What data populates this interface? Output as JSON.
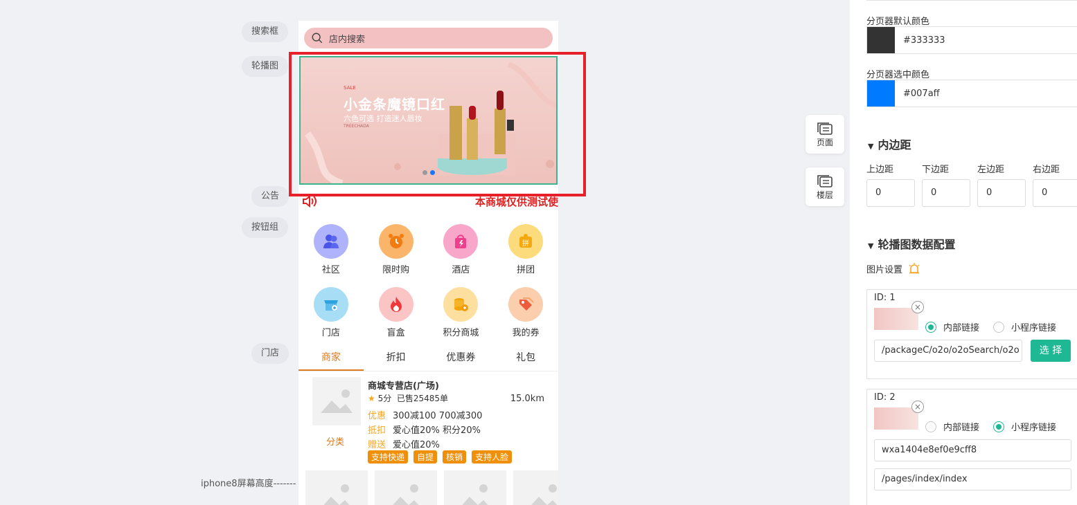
{
  "side_labels": {
    "search": "搜索框",
    "carousel": "轮播图",
    "notice": "公告",
    "button_group": "按钮组",
    "store": "门店",
    "iphone_line": "iphone8屏幕高度-------"
  },
  "phone": {
    "search": {
      "placeholder": "店内搜索",
      "icon": "search-icon"
    },
    "banner": {
      "tag": "SALE",
      "title": "小金条魔镜口红",
      "subtitle": "六色可选 打造迷人唇妆",
      "brand": "TREECHADA",
      "active_dot": 2,
      "dot_count": 2
    },
    "notice": {
      "icon": "speaker-icon",
      "text": "本商城仅供测试使"
    },
    "buttons": [
      {
        "label": "社区",
        "icon": "community-icon",
        "color": "#7b83f5"
      },
      {
        "label": "限时购",
        "icon": "alarm-clock-icon",
        "color": "#f59a3c"
      },
      {
        "label": "酒店",
        "icon": "shopping-bag-icon",
        "color": "#f56aa5"
      },
      {
        "label": "拼团",
        "icon": "puzzle-icon",
        "color": "#f8c43c"
      },
      {
        "label": "门店",
        "icon": "shop-icon",
        "color": "#58b8ea"
      },
      {
        "label": "盲盒",
        "icon": "fire-icon",
        "color": "#f45a5a"
      },
      {
        "label": "积分商城",
        "icon": "coins-icon",
        "color": "#f8b833"
      },
      {
        "label": "我的券",
        "icon": "coupon-tag-icon",
        "color": "#f37b5a"
      }
    ],
    "tabs": [
      {
        "label": "商家",
        "active": true
      },
      {
        "label": "折扣",
        "active": false
      },
      {
        "label": "优惠券",
        "active": false
      },
      {
        "label": "礼包",
        "active": false
      }
    ],
    "store": {
      "name": "商城专营店(广场)",
      "score": "5分",
      "sold": "已售25485单",
      "distance": "15.0km",
      "category": "分类",
      "rows": [
        {
          "key": "优惠",
          "value": "300减100   700减300"
        },
        {
          "key": "抵扣",
          "value": "爱心值20%   积分20%"
        },
        {
          "key": "赠送",
          "value": "爱心值20%"
        }
      ],
      "badges": [
        "支持快递",
        "自提",
        "核销",
        "支持人脸"
      ]
    }
  },
  "float_buttons": [
    {
      "label": "页面",
      "icon": "page-icon"
    },
    {
      "label": "楼层",
      "icon": "floor-icon"
    }
  ],
  "panel": {
    "pager_default_label": "分页器默认颜色",
    "pager_default_color": "#333333",
    "pager_selected_label": "分页器选中颜色",
    "pager_selected_color": "#007aff",
    "padding_title": "内边距",
    "padding_labels": [
      "上边距",
      "下边距",
      "左边距",
      "右边距"
    ],
    "padding_values": [
      "0",
      "0",
      "0",
      "0"
    ],
    "carousel_title": "轮播图数据配置",
    "image_setting_label": "图片设置",
    "link_internal": "内部链接",
    "link_miniprogram": "小程序链接",
    "select_label": "选 择",
    "items": [
      {
        "id": "ID:  1",
        "link_type": "internal",
        "path": "/packageC/o2o/o2oSearch/o2o"
      },
      {
        "id": "ID:  2",
        "link_type": "miniprogram",
        "appid": "wxa1404e8ef0e9cff8",
        "path": "/pages/index/index"
      }
    ]
  }
}
